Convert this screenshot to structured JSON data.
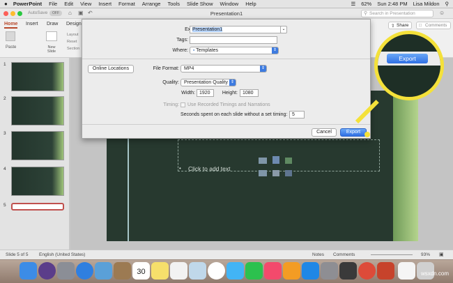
{
  "menubar": {
    "app": "PowerPoint",
    "items": [
      "File",
      "Edit",
      "View",
      "Insert",
      "Format",
      "Arrange",
      "Tools",
      "Slide Show",
      "Window",
      "Help"
    ],
    "battery": "62%",
    "clock": "Sun 2:48 PM",
    "user": "Lisa Mildon"
  },
  "titlebar": {
    "autosave": "AutoSave",
    "autosave_state": "OFF",
    "title": "Presentation1",
    "search_placeholder": "Search in Presentation"
  },
  "ribbon": {
    "tabs": [
      "Home",
      "Insert",
      "Draw",
      "Design"
    ],
    "paste": "Paste",
    "new_slide": "New Slide",
    "layout": "Layout",
    "reset": "Reset",
    "section": "Section",
    "share": "Share",
    "comments": "Comments"
  },
  "slides": [
    "1",
    "2",
    "3",
    "4",
    "5"
  ],
  "slide": {
    "placeholder": "Click to add text",
    "bullet": "•"
  },
  "dialog": {
    "export_as_label": "Export As:",
    "export_as_value": "Presentation1",
    "tags_label": "Tags:",
    "where_label": "Where:",
    "where_value": "Templates",
    "online_locations": "Online Locations",
    "file_format_label": "File Format:",
    "file_format_value": "MP4",
    "quality_label": "Quality:",
    "quality_value": "Presentation Quality",
    "width_label": "Width:",
    "width_value": "1920",
    "height_label": "Height:",
    "height_value": "1080",
    "timing_label": "Timing:",
    "timing_option": "Use Recorded Timings and Narrations",
    "seconds_label": "Seconds spent on each slide without a set timing:",
    "seconds_value": "5",
    "cancel": "Cancel",
    "export": "Export"
  },
  "magnifier": {
    "export": "Export"
  },
  "statusbar": {
    "slide_count": "Slide 5 of 5",
    "language": "English (United States)",
    "notes": "Notes",
    "comments": "Comments",
    "zoom": "93%"
  },
  "dock": {
    "calendar_day": "30"
  },
  "watermark": "wsxdn.com",
  "colors": {
    "accent": "#2f6fe4",
    "highlight": "#f4e13a",
    "slide_bg": "#27392f"
  }
}
